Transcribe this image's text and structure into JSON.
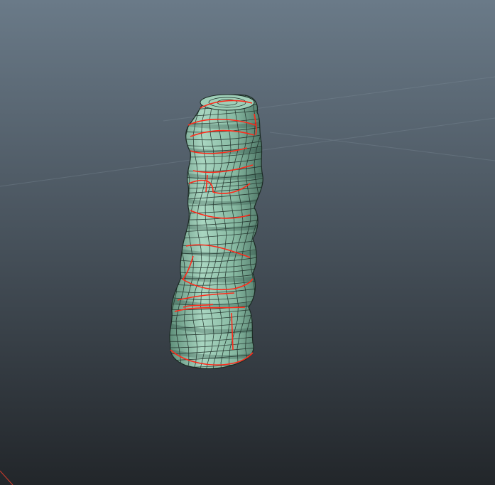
{
  "viewport": {
    "background_top": "#6a7a88",
    "background_bottom": "#22262a",
    "grid_color": "#7f8e9a"
  },
  "object": {
    "kind": "sculpted-rock-column",
    "fill_color": "#8fbfaa",
    "wire_color": "#1c2a24",
    "seam_color": "#ff2a1a"
  }
}
